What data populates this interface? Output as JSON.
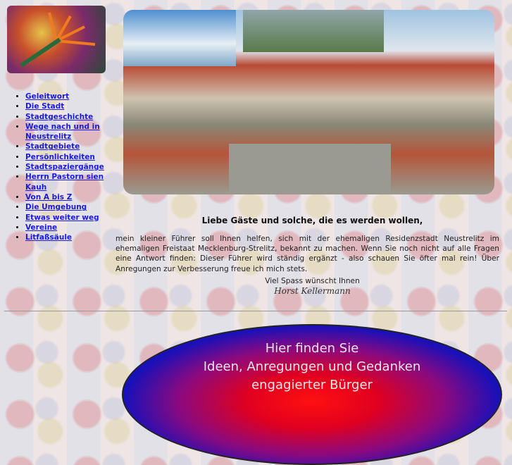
{
  "nav": [
    "Geleitwort",
    "Die Stadt",
    "Stadtgeschichte",
    "Wege nach und in Neustrelitz",
    "Stadtgebiete",
    "Persönlichkeiten",
    "Stadtspaziergänge",
    "Herrn Pastorn sien Kauh",
    "Von A bis Z",
    "Die Umgebung",
    "Etwas weiter weg",
    "Vereine",
    "Litfaßsäule"
  ],
  "greeting": "Liebe Gäste und solche, die es werden wollen,",
  "intro": "mein kleiner Führer soll Ihnen helfen, sich mit der ehemaligen Residenzstadt Neustrelitz im ehemaligen Freistaat Mecklenburg-Strelitz, bekannt zu machen. Wenn Sie noch nicht auf alle Fragen eine Antwort finden: Dieser Führer wird ständig ergänzt - also schauen Sie öfter mal rein! Über Anregungen zur Verbesserung freue ich mich stets.",
  "closing": "Viel Spass wünscht Ihnen",
  "signature": "Horst Kellermann",
  "banner": {
    "line1": "Hier finden Sie",
    "line2": "Ideen, Anregungen und Gedanken",
    "line3": "engagierter Bürger"
  }
}
